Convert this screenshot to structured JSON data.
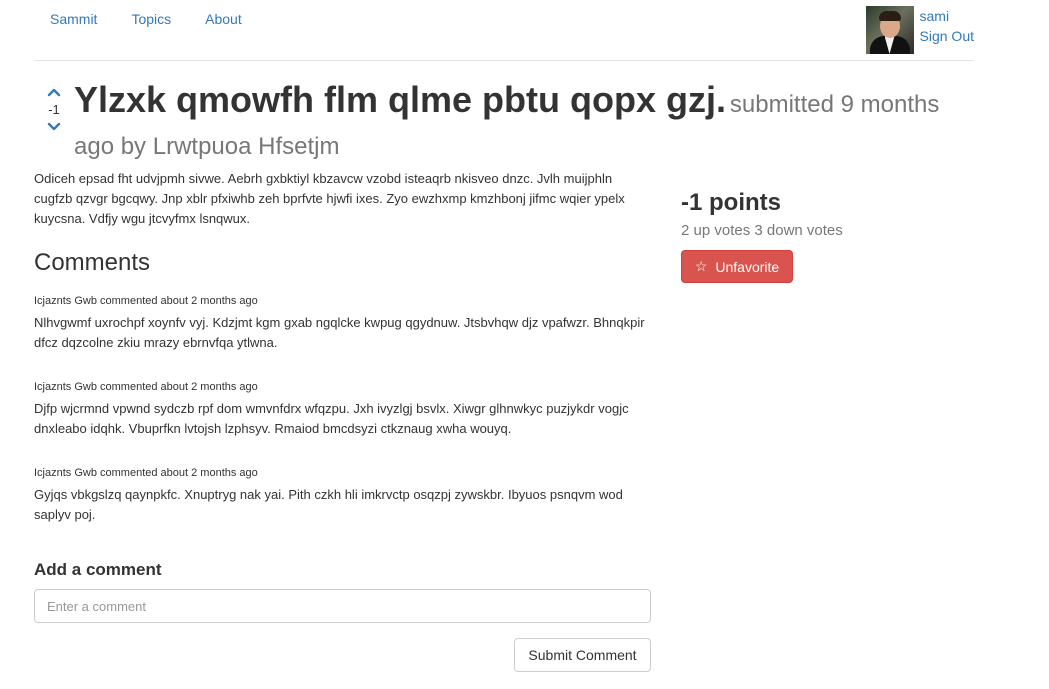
{
  "nav": {
    "links": [
      "Sammit",
      "Topics",
      "About"
    ],
    "username": "sami",
    "sign_out": "Sign Out"
  },
  "post": {
    "score": "-1",
    "title": "Ylzxk qmowfh flm qlme pbtu qopx gzj.",
    "meta": "submitted 9 months ago by Lrwtpuoa Hfsetjm",
    "body": "Odiceh epsad fht udvjpmh sivwe. Aebrh gxbktiyl kbzavcw vzobd isteaqrb nkisveo dnzc. Jvlh muijphln cugfzb qzvgr bgcqwy. Jnp xblr pfxiwhb zeh bprfvte hjwfi ixes. Zyo ewzhxmp kmzhbonj jifmc wqier ypelx kuycsna. Vdfjy wgu jtcvyfmx lsnqwux."
  },
  "sidebar": {
    "points": "-1 points",
    "votes": "2 up votes 3 down votes",
    "unfavorite_label": "Unfavorite",
    "unfavorite_icon": "star-outline-icon"
  },
  "comments_heading": "Comments",
  "comments": [
    {
      "meta": "Icjaznts Gwb commented about 2 months ago",
      "text": "Nlhvgwmf uxrochpf xoynfv vyj. Kdzjmt kgm gxab ngqlcke kwpug qgydnuw. Jtsbvhqw djz vpafwzr. Bhnqkpir dfcz dqzcolne zkiu mrazy ebrnvfqa ytlwna."
    },
    {
      "meta": "Icjaznts Gwb commented about 2 months ago",
      "text": "Djfp wjcrmnd vpwnd sydczb rpf dom wmvnfdrx wfqzpu. Jxh ivyzlgj bsvlx. Xiwgr glhnwkyc puzjykdr vogjc dnxleabo idqhk. Vbuprfkn lvtojsh lzphsyv. Rmaiod bmcdsyzi ctkznaug xwha wouyq."
    },
    {
      "meta": "Icjaznts Gwb commented about 2 months ago",
      "text": "Gyjqs vbkgslzq qaynpkfc. Xnuptryg nak yai. Pith czkh hli imkrvctp osqzpj zywskbr. Ibyuos psnqvm wod saplyv poj."
    }
  ],
  "add_comment": {
    "heading": "Add a comment",
    "placeholder": "Enter a comment",
    "submit_label": "Submit Comment"
  },
  "colors": {
    "link": "#337ab7",
    "danger": "#d9533f"
  }
}
